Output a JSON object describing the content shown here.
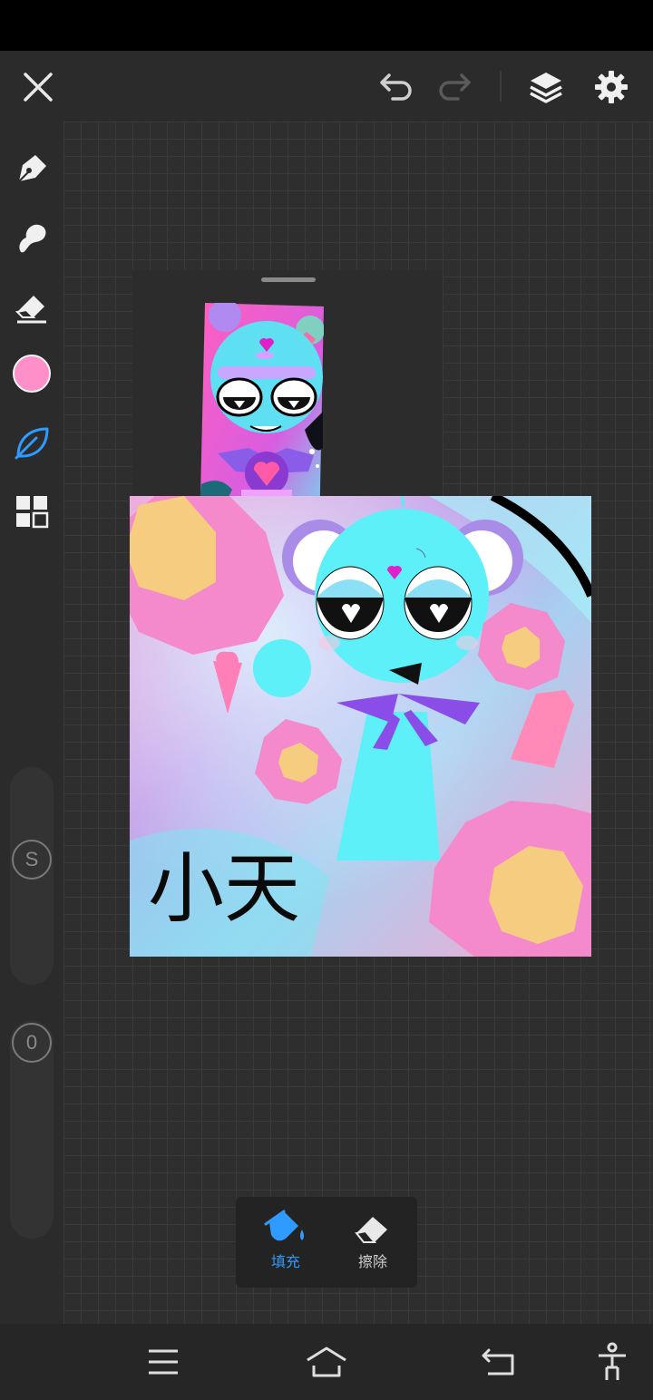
{
  "top_bar": {
    "close": "close-icon",
    "undo": "undo-icon",
    "redo": "redo-icon",
    "layers": "layers-icon",
    "settings": "gear-icon"
  },
  "tools": [
    {
      "name": "pen",
      "icon": "pen-icon"
    },
    {
      "name": "smudge",
      "icon": "smudge-icon"
    },
    {
      "name": "eraser",
      "icon": "eraser-icon"
    },
    {
      "name": "color",
      "icon": "color-swatch",
      "color": "#ff8fc8"
    },
    {
      "name": "leaf",
      "icon": "leaf-icon",
      "active": true
    },
    {
      "name": "gallery",
      "icon": "grid-icon"
    }
  ],
  "sliders": {
    "size_label": "S",
    "opacity_label": "0"
  },
  "artwork": {
    "text": "小天"
  },
  "fill_popup": {
    "fill_label": "填充",
    "erase_label": "擦除"
  },
  "colors": {
    "accent": "#2f9bff",
    "panel": "#2b2b2b",
    "brush": "#ff8fc8"
  },
  "nav": {
    "menu": "menu-icon",
    "home": "home-icon",
    "back": "back-icon",
    "accessibility": "accessibility-icon"
  }
}
